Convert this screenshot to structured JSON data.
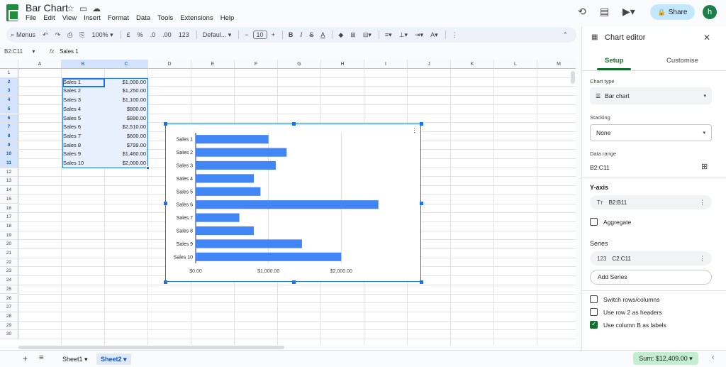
{
  "app": {
    "doc_title": "Bar Chart",
    "menu": [
      "File",
      "Edit",
      "View",
      "Insert",
      "Format",
      "Data",
      "Tools",
      "Extensions",
      "Help"
    ],
    "share_label": "Share",
    "avatar_letter": "h"
  },
  "toolbar": {
    "menus_label": "Menus",
    "zoom": "100%",
    "currency": "£",
    "percent": "%",
    "dec_dec": ".0",
    "dec_inc": ".00",
    "number_format": "123",
    "font": "Defaul...",
    "font_size": "10"
  },
  "formula_bar": {
    "name_box": "B2:C11",
    "fx": "fx",
    "value": "Sales 1"
  },
  "grid": {
    "columns": [
      "A",
      "B",
      "C",
      "D",
      "E",
      "F",
      "G",
      "H",
      "I",
      "J",
      "K",
      "L",
      "M"
    ],
    "rows": [
      "1",
      "2",
      "3",
      "4",
      "5",
      "6",
      "7",
      "8",
      "9",
      "10",
      "11",
      "12",
      "13",
      "14",
      "15",
      "16",
      "17",
      "18",
      "19",
      "20",
      "21",
      "22",
      "23",
      "24",
      "25",
      "26",
      "27",
      "28",
      "29",
      "30"
    ],
    "data": [
      {
        "label": "Sales 1",
        "value": "$1,000.00"
      },
      {
        "label": "Sales 2",
        "value": "$1,250.00"
      },
      {
        "label": "Sales 3",
        "value": "$1,100.00"
      },
      {
        "label": "Sales 4",
        "value": "$800.00"
      },
      {
        "label": "Sales 5",
        "value": "$890.00"
      },
      {
        "label": "Sales 6",
        "value": "$2,510.00"
      },
      {
        "label": "Sales 7",
        "value": "$600.00"
      },
      {
        "label": "Sales 8",
        "value": "$799.00"
      },
      {
        "label": "Sales 9",
        "value": "$1,460.00"
      },
      {
        "label": "Sales 10",
        "value": "$2,000.00"
      }
    ]
  },
  "chart_data": {
    "type": "bar",
    "orientation": "horizontal",
    "categories": [
      "Sales 1",
      "Sales 2",
      "Sales 3",
      "Sales 4",
      "Sales 5",
      "Sales 6",
      "Sales 7",
      "Sales 8",
      "Sales 9",
      "Sales 10"
    ],
    "values": [
      1000,
      1250,
      1100,
      800,
      890,
      2510,
      600,
      799,
      1460,
      2000
    ],
    "x_ticks": [
      "$0.00",
      "$1,000.00",
      "$2,000.00"
    ],
    "xlim": [
      0,
      3000
    ],
    "bar_color": "#4285f4",
    "grid": true,
    "legend": "none"
  },
  "sheets": {
    "tabs": [
      "Sheet1",
      "Sheet2"
    ],
    "active": "Sheet2",
    "sum": "Sum: $12,409.00"
  },
  "panel": {
    "title": "Chart editor",
    "tabs": [
      "Setup",
      "Customise"
    ],
    "chart_type_label": "Chart type",
    "chart_type": "Bar chart",
    "stacking_label": "Stacking",
    "stacking": "None",
    "data_range_label": "Data range",
    "data_range": "B2:C11",
    "y_axis_heading": "Y-axis",
    "y_axis_range": "B2:B11",
    "aggregate": "Aggregate",
    "series_heading": "Series",
    "series_range": "C2:C11",
    "add_series": "Add Series",
    "switch_rows": "Switch rows/columns",
    "use_row2": "Use row 2 as headers",
    "use_colB": "Use column B as labels"
  }
}
